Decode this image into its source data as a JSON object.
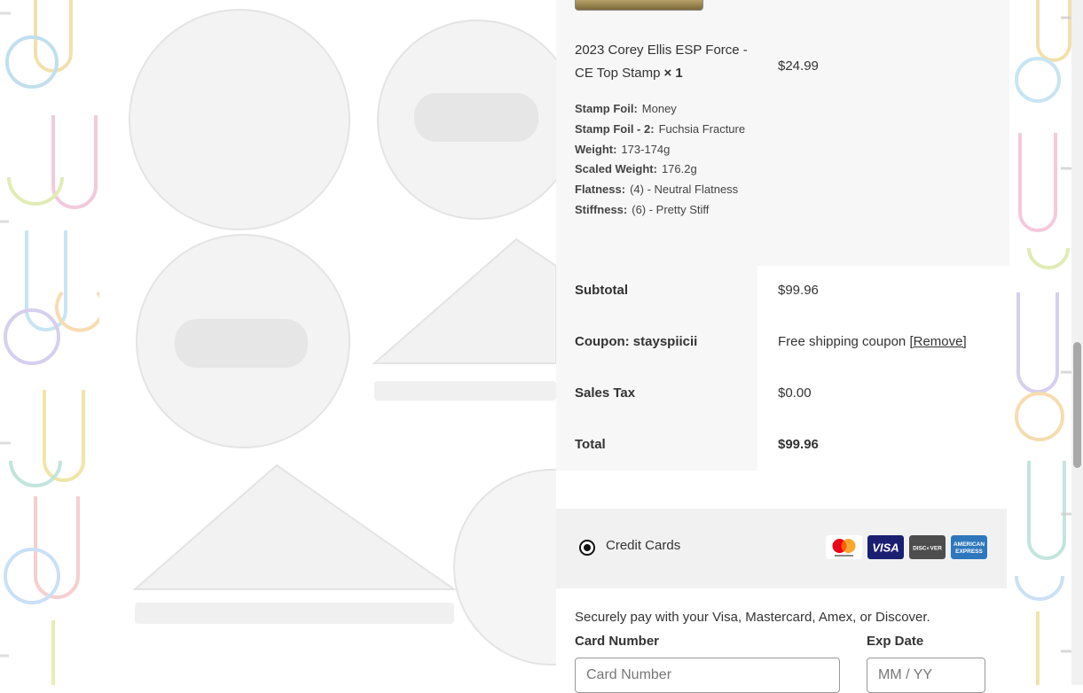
{
  "item": {
    "name": "2023 Corey Ellis ESP Force - CE Top Stamp",
    "quantity": "× 1",
    "price": "$24.99",
    "meta": [
      {
        "key": "Stamp Foil:",
        "value": "Money"
      },
      {
        "key": "Stamp Foil - 2:",
        "value": "Fuchsia Fracture"
      },
      {
        "key": "Weight:",
        "value": "173-174g"
      },
      {
        "key": "Scaled Weight:",
        "value": "176.2g"
      },
      {
        "key": "Flatness:",
        "value": "(4) - Neutral Flatness"
      },
      {
        "key": "Stiffness:",
        "value": "(6) - Pretty Stiff"
      }
    ]
  },
  "totals": {
    "subtotal_label": "Subtotal",
    "subtotal_value": "$99.96",
    "coupon_label": "Coupon: stayspiicii",
    "coupon_value": "Free shipping coupon",
    "coupon_remove": "[Remove]",
    "tax_label": "Sales Tax",
    "tax_value": "$0.00",
    "total_label": "Total",
    "total_value": "$99.96"
  },
  "payment": {
    "method_label": "Credit Cards",
    "description": "Securely pay with your Visa, Mastercard, Amex, or Discover.",
    "card_logos": [
      "mastercard-icon",
      "visa-icon",
      "discover-icon",
      "amex-icon"
    ],
    "card_number_label": "Card Number",
    "card_number_placeholder": "Card Number",
    "exp_label": "Exp Date",
    "exp_placeholder": "MM / YY"
  },
  "colors": {
    "panel_gray": "#f7f7f8",
    "payment_gray": "#f1f1f2",
    "visa_blue": "#1a1f71",
    "discover_gray": "#4d4d4d",
    "amex_blue": "#2e77bc"
  }
}
